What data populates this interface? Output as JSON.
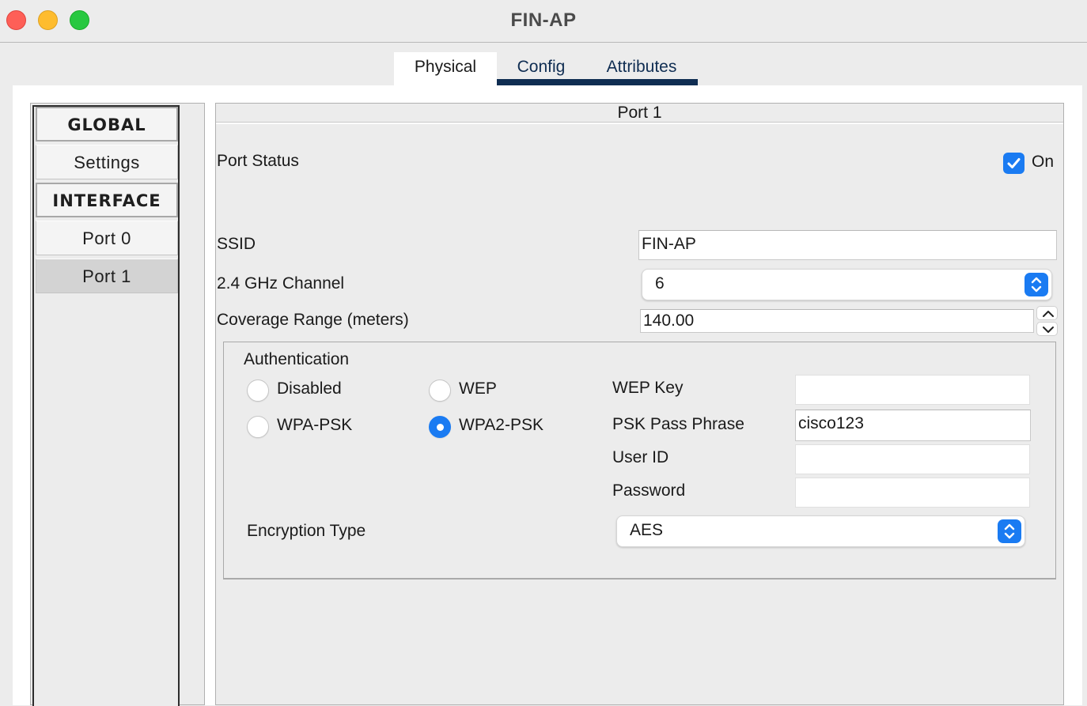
{
  "window": {
    "title": "FIN-AP"
  },
  "tabs": [
    {
      "label": "Physical"
    },
    {
      "label": "Config"
    },
    {
      "label": "Attributes"
    }
  ],
  "nav": {
    "global_header": "GLOBAL",
    "settings": "Settings",
    "interface_header": "INTERFACE",
    "port0": "Port 0",
    "port1": "Port 1",
    "selected": "Port 1"
  },
  "panel": {
    "title": "Port 1",
    "port_status_label": "Port Status",
    "port_status_checkbox_label": "On",
    "port_status_on": true,
    "ssid_label": "SSID",
    "ssid_value": "FIN-AP",
    "channel_label": "2.4 GHz Channel",
    "channel_value": "6",
    "coverage_label": "Coverage Range (meters)",
    "coverage_value": "140.00"
  },
  "auth": {
    "title": "Authentication",
    "options": {
      "disabled": "Disabled",
      "wep": "WEP",
      "wpa_psk": "WPA-PSK",
      "wpa2_psk": "WPA2-PSK"
    },
    "selected": "WPA2-PSK",
    "wep_key_label": "WEP Key",
    "wep_key_value": "",
    "psk_label": "PSK Pass Phrase",
    "psk_value": "cisco123",
    "user_id_label": "User ID",
    "user_id_value": "",
    "password_label": "Password",
    "password_value": "",
    "encryption_label": "Encryption Type",
    "encryption_value": "AES"
  },
  "colors": {
    "accent": "#1a7bf2",
    "tab_underline": "#0f2d52",
    "close": "#fe5f57",
    "minimize": "#febc2e",
    "zoom": "#28c840"
  }
}
